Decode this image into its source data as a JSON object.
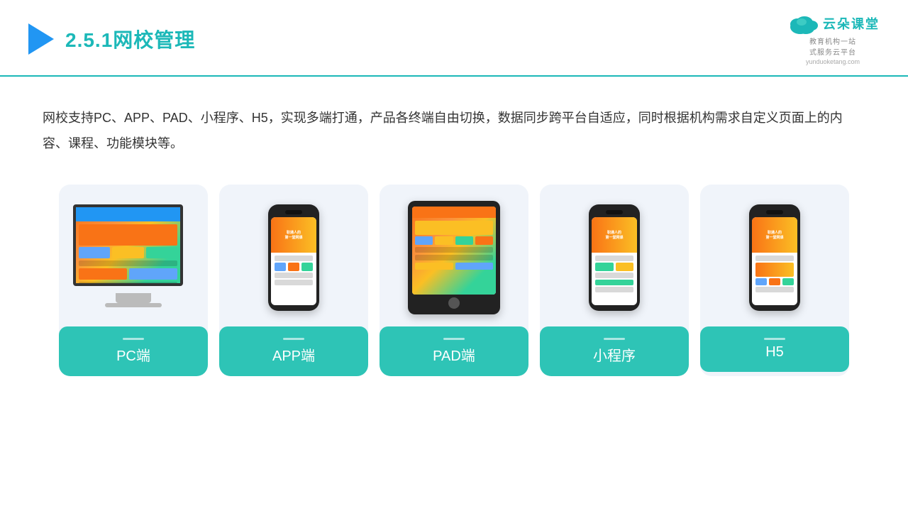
{
  "header": {
    "title_prefix": "2.5.1",
    "title_main": "网校管理",
    "logo_brand": "云朵课堂",
    "logo_url": "yunduoketang.com",
    "logo_sub": "教育机构一站\n式服务云平台"
  },
  "description": {
    "text": "网校支持PC、APP、PAD、小程序、H5，实现多端打通，产品各终端自由切换，数据同步跨平台自适应，同时根据机构需求自定义页面上的内容、课程、功能模块等。"
  },
  "cards": [
    {
      "id": "pc",
      "label": "PC端",
      "device": "monitor"
    },
    {
      "id": "app",
      "label": "APP端",
      "device": "phone"
    },
    {
      "id": "pad",
      "label": "PAD端",
      "device": "tablet"
    },
    {
      "id": "mini",
      "label": "小程序",
      "device": "phone2"
    },
    {
      "id": "h5",
      "label": "H5",
      "device": "phone3"
    }
  ]
}
